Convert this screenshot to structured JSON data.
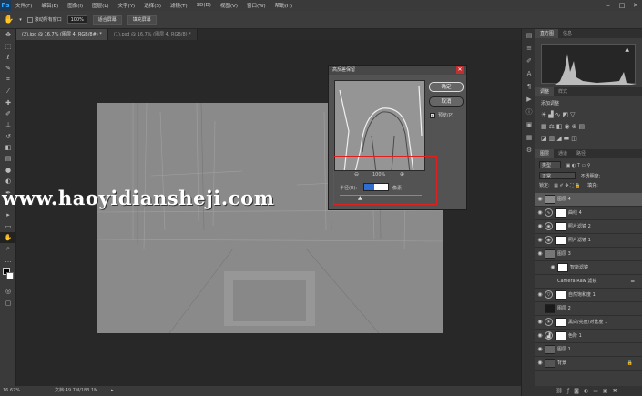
{
  "app": {
    "logo": "Ps"
  },
  "menu": [
    "文件(F)",
    "编辑(E)",
    "图像(I)",
    "图层(L)",
    "文字(Y)",
    "选择(S)",
    "滤镜(T)",
    "3D(D)",
    "视图(V)",
    "窗口(W)",
    "帮助(H)"
  ],
  "options": {
    "tool_icon": "hand-icon",
    "scroll_all_label": "滚动所有窗口",
    "zoom": "100%",
    "fit_screen": "适合屏幕",
    "fill_screen": "填充屏幕"
  },
  "tabs": [
    {
      "label": "(2).jpg @ 16.7% (图层 4, RGB/8#) *",
      "active": true
    },
    {
      "label": "(1).psd @ 16.7% (图层 4, RGB/8) *",
      "active": false
    }
  ],
  "dialog": {
    "title": "高反差保留",
    "ok": "确定",
    "cancel": "取消",
    "preview_label": "预览(P)",
    "zoom": "100%",
    "radius_label": "半径(R):",
    "radius_value": "0.8",
    "unit": "像素"
  },
  "status": {
    "zoom": "16.67%",
    "doc": "文档:49.7M/183.1M"
  },
  "panels": {
    "top_tabs": [
      "直方图",
      "信息"
    ],
    "mid_tabs": [
      "调整",
      "样式"
    ],
    "add_adjust": "添加调整",
    "layers_tabs": [
      "图层",
      "通道",
      "路径"
    ],
    "kind": "类型",
    "blend": "正常",
    "opacity_label": "不透明度:",
    "lock_label": "锁定:",
    "fill_label": "填充:",
    "layers": [
      {
        "name": "图层 4",
        "type": "pixel"
      },
      {
        "name": "曲线 4",
        "type": "adjust"
      },
      {
        "name": "照片滤镜 2",
        "type": "adjust"
      },
      {
        "name": "照片滤镜 1",
        "type": "adjust"
      },
      {
        "name": "图层 3",
        "type": "smart"
      },
      {
        "name": "智能滤镜",
        "type": "sub"
      },
      {
        "name": "Camera Raw 滤镜",
        "type": "sub"
      },
      {
        "name": "自然饱和度 1",
        "type": "adjust"
      },
      {
        "name": "图层 2",
        "type": "dark"
      },
      {
        "name": "黑白/亮度/对比度 1",
        "type": "adjust"
      },
      {
        "name": "色阶 1",
        "type": "adjust"
      },
      {
        "name": "图层 1",
        "type": "pixel"
      },
      {
        "name": "背景",
        "type": "bg"
      }
    ]
  },
  "watermark": "www.haoyidiansheji.com"
}
